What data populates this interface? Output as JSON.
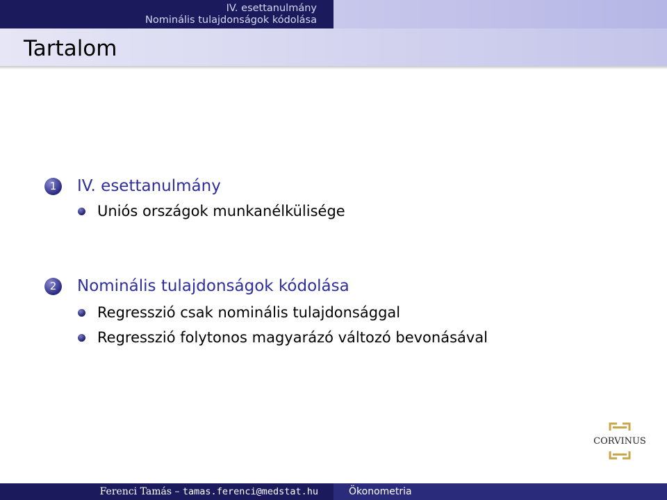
{
  "header": {
    "section": "IV. esettanulmány",
    "subsection": "Nominális tulajdonságok kódolása"
  },
  "frame": {
    "title": "Tartalom"
  },
  "toc": {
    "sections": [
      {
        "number": "1",
        "title": "IV. esettanulmány",
        "subsections": [
          "Uniós országok munkanélkülisége"
        ]
      },
      {
        "number": "2",
        "title": "Nominális tulajdonságok kódolása",
        "subsections": [
          "Regresszió csak nominális tulajdonsággal",
          "Regresszió folytonos magyarázó változó bevonásával"
        ]
      }
    ]
  },
  "logo": {
    "text": "CORVINUS"
  },
  "footer": {
    "author": "Ferenci Tamás",
    "separator": " – ",
    "email": "tamas.ferenci@medstat.hu",
    "course": "Ökonometria"
  },
  "colors": {
    "header_dark": "#1a1a5c",
    "section_title": "#2d2d9e",
    "footer_right": "#2b2b7c"
  }
}
